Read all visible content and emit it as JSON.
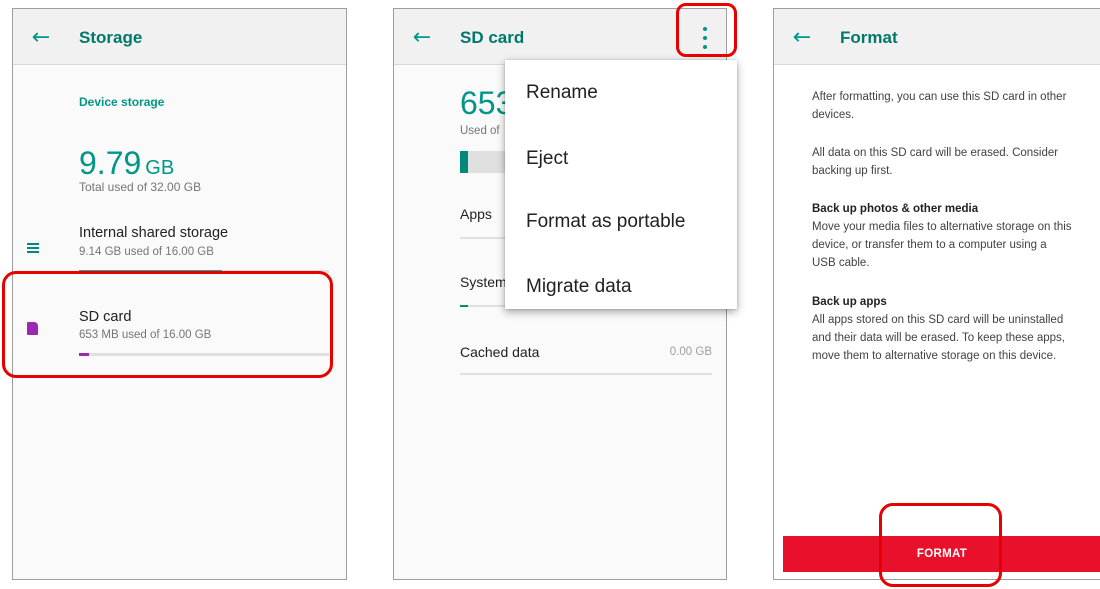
{
  "storage": {
    "title": "Storage",
    "section": "Device storage",
    "used_value": "9.79",
    "used_unit": "GB",
    "total_text": "Total used of 32.00 GB",
    "items": [
      {
        "label": "Internal shared storage",
        "detail": "9.14 GB used of 16.00 GB",
        "icon": "storage-list-icon",
        "fill_fraction": 0.57,
        "color": "#26a69a"
      },
      {
        "label": "SD card",
        "detail": "653 MB used of 16.00 GB",
        "icon": "sd-card-icon",
        "fill_fraction": 0.04,
        "color": "#9c27b0"
      }
    ]
  },
  "sdcard": {
    "title": "SD card",
    "usage_value": "653",
    "usage_sub": "Used of",
    "usage_fill_fraction": 0.12,
    "categories": [
      {
        "label": "Apps",
        "size": "",
        "fill_fraction": 0.0
      },
      {
        "label": "System",
        "size": "",
        "fill_fraction": 0.03
      },
      {
        "label": "Cached data",
        "size": "0.00 GB",
        "fill_fraction": 0.0
      }
    ],
    "menu": [
      "Rename",
      "Eject",
      "Format as portable",
      "Migrate data"
    ]
  },
  "format": {
    "title": "Format",
    "intro": "After formatting, you can use this SD card in other devices.",
    "warning": "All data on this SD card will be erased. Consider backing up first.",
    "photos_heading": "Back up photos & other media",
    "photos_body": "Move your media files to alternative storage on this device, or transfer them to a computer using a USB cable.",
    "apps_heading": "Back up apps",
    "apps_body": "All apps stored on this SD card will be uninstalled and their data will be erased. To keep these apps, move them to alternative storage on this device.",
    "button": "FORMAT"
  },
  "colors": {
    "accent": "#009688",
    "highlight": "#e60000",
    "format_button": "#e8102a"
  },
  "icons": {
    "back": "arrow-left-icon",
    "overflow": "more-vert-icon"
  }
}
